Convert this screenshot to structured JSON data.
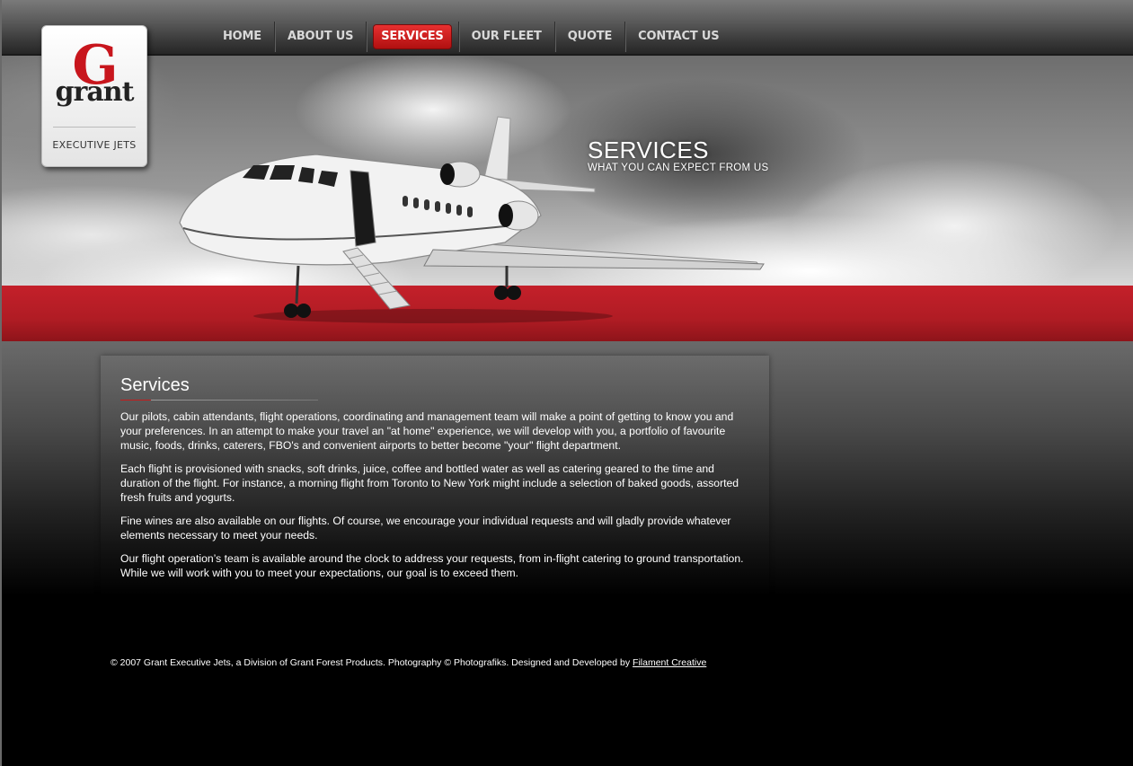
{
  "nav": [
    {
      "label": "HOME",
      "active": false
    },
    {
      "label": "ABOUT US",
      "active": false
    },
    {
      "label": "SERVICES",
      "active": true
    },
    {
      "label": "OUR FLEET",
      "active": false
    },
    {
      "label": "QUOTE",
      "active": false
    },
    {
      "label": "CONTACT US",
      "active": false
    }
  ],
  "logo": {
    "letter": "G",
    "word": "grant",
    "tagline": "EXECUTIVE JETS"
  },
  "hero": {
    "title": "SERVICES",
    "subtitle": "WHAT YOU CAN EXPECT FROM US"
  },
  "content": {
    "title": "Services",
    "paragraphs": [
      "Our pilots, cabin attendants, flight operations, coordinating and management team will make a point of getting to know you and your preferences. In an attempt to make your travel an \"at home\" experience, we will develop with you, a portfolio of favourite music, foods, drinks, caterers, FBO's and convenient airports to better become \"your\" flight department.",
      "Each flight is provisioned with snacks, soft drinks, juice, coffee and bottled water as well as catering geared to the time and duration of the flight. For instance, a morning flight from Toronto to New York might include a selection of baked goods, assorted fresh fruits and yogurts.",
      "Fine wines are also available on our flights. Of course, we encourage your individual requests and will gladly provide whatever elements necessary to meet your needs.",
      "Our flight operation’s team is available around the clock to address your requests, from in-flight catering to ground transportation. While we will work with you to meet your expectations, our goal is to exceed them."
    ]
  },
  "footer": {
    "text": "© 2007 Grant Executive Jets, a Division of Grant Forest Products. Photography © Photografiks. Designed and Developed by ",
    "link": "Filament Creative"
  },
  "colors": {
    "accent_red": "#c41b1b",
    "nav_text": "#d8d8d8"
  }
}
